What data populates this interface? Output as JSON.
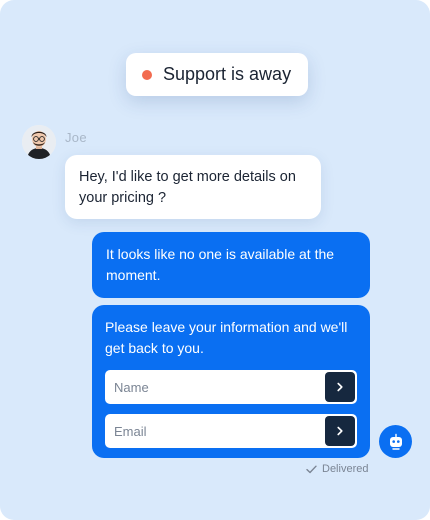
{
  "status": {
    "label": "Support is away",
    "dot_color": "#f26b4f"
  },
  "conversation": {
    "sender_name": "Joe",
    "incoming_message": "Hey, I'd like to get more details on your pricing ?",
    "outgoing_messages": [
      "It looks like no one is available at the moment.",
      "Please leave your information and we'll get back to you."
    ]
  },
  "form": {
    "name_placeholder": "Name",
    "email_placeholder": "Email",
    "submit_icon": "chevron-right-icon"
  },
  "delivery_status": "Delivered",
  "colors": {
    "accent": "#0a6ff2",
    "dark_button": "#16283f",
    "background": "#d9e9fb"
  }
}
